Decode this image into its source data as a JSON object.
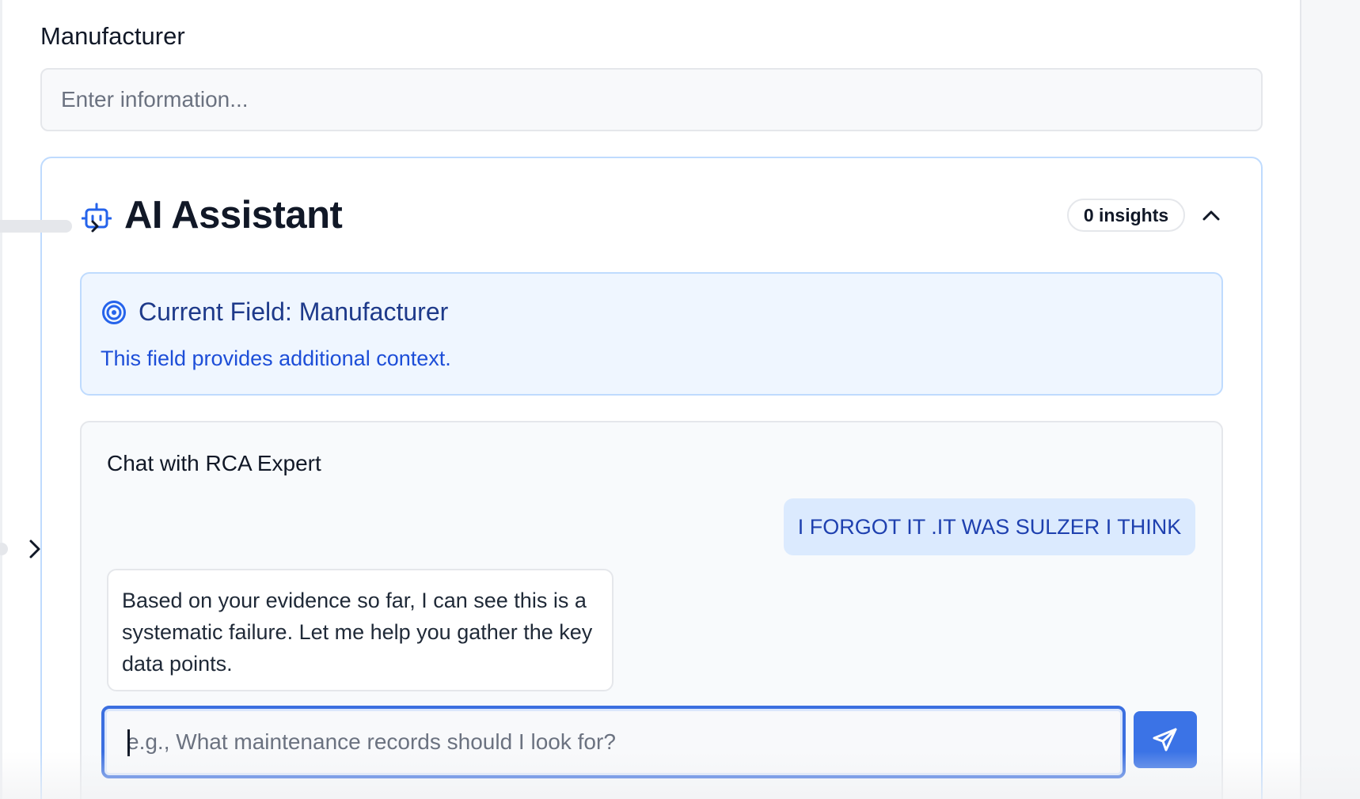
{
  "field": {
    "label": "Manufacturer",
    "placeholder": "Enter information...",
    "value": ""
  },
  "assistant": {
    "title": "AI Assistant",
    "insights_badge": "0 insights",
    "icons": {
      "header": "robot-icon",
      "collapse": "chevron-up-icon",
      "context": "target-icon",
      "send": "send-icon",
      "side_expand": "chevron-right-icon"
    },
    "context": {
      "title": "Current Field: Manufacturer",
      "description": "This field provides additional context."
    },
    "chat": {
      "title": "Chat with RCA Expert",
      "messages": [
        {
          "role": "user",
          "text": "I FORGOT IT .IT WAS SULZER I THINK"
        },
        {
          "role": "assistant",
          "text": "Based on your evidence so far, I can see this is a systematic failure. Let me help you gather the key data points."
        }
      ],
      "input_placeholder": "e.g., What maintenance records should I look for?",
      "input_value": ""
    }
  },
  "colors": {
    "accent": "#3b73e6",
    "context_bg": "#eff6ff",
    "context_border": "#bfdbfe",
    "context_title": "#1e3a8a",
    "context_text": "#1d4ed8",
    "user_bubble": "#dbeafe",
    "user_text": "#1e40af"
  }
}
